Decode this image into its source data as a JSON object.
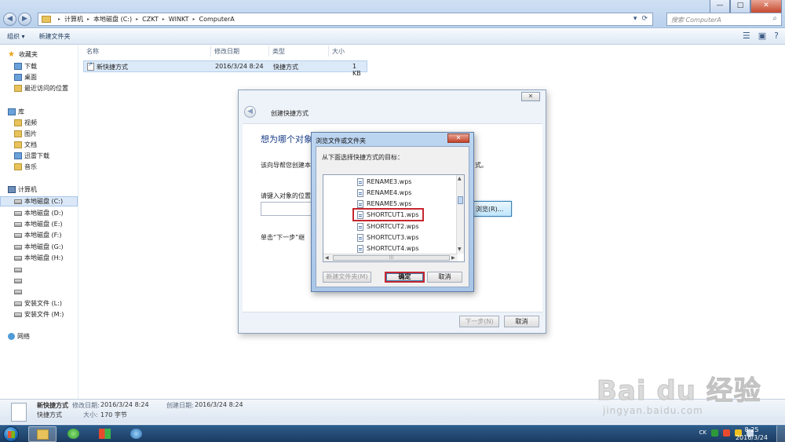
{
  "address": {
    "segments": [
      "计算机",
      "本地磁盘 (C:)",
      "CZKT",
      "WINKT",
      "ComputerA"
    ],
    "search_placeholder": "搜索 ComputerA"
  },
  "toolbar": {
    "organize": "组织 ▾",
    "new_folder": "新建文件夹"
  },
  "sidebar": {
    "favorites": "收藏夹",
    "downloads": "下载",
    "desktop": "桌面",
    "recent": "最近访问的位置",
    "libraries": "库",
    "videos": "视频",
    "pictures": "图片",
    "documents": "文档",
    "xunlei": "迅雷下载",
    "music": "音乐",
    "computer": "计算机",
    "drives": [
      "本地磁盘 (C:)",
      "本地磁盘 (D:)",
      "本地磁盘 (E:)",
      "本地磁盘 (F:)",
      "本地磁盘 (G:)",
      "本地磁盘 (H:)",
      "",
      "",
      "",
      "安装文件 (L:)",
      "安装文件 (M:)"
    ],
    "network": "网络"
  },
  "filelist": {
    "headers": {
      "name": "名称",
      "modified": "修改日期",
      "type": "类型",
      "size": "大小"
    },
    "rows": [
      {
        "name": "新快捷方式",
        "modified": "2016/3/24 8:24",
        "type": "快捷方式",
        "size": "1 KB"
      }
    ]
  },
  "wizard": {
    "title": "创建快捷方式",
    "close": "✕",
    "heading": "想为哪个对象",
    "desc": "该向导帮您创建本",
    "desc_tail": "式。",
    "location_label": "请键入对象的位置(",
    "browse_button": "浏览(R)...",
    "next_hint": "单击“下一步”继",
    "next_button": "下一步(N)",
    "cancel_button": "取消"
  },
  "browse_dialog": {
    "title": "浏览文件或文件夹",
    "close": "✕",
    "prompt": "从下面选择快捷方式的目标：",
    "items": [
      "RENAME3.wps",
      "RENAME4.wps",
      "RENAME5.wps",
      "SHORTCUT1.wps",
      "SHORTCUT2.wps",
      "SHORTCUT3.wps",
      "SHORTCUT4.wps"
    ],
    "selected_index": 3,
    "new_folder_button": "新建文件夹(M)",
    "ok_button": "确定",
    "cancel_button": "取消"
  },
  "details": {
    "name": "新快捷方式",
    "type": "快捷方式",
    "modified_label": "修改日期:",
    "modified_value": "2016/3/24 8:24",
    "created_label": "创建日期:",
    "created_value": "2016/3/24 8:24",
    "size_label": "大小:",
    "size_value": "170 字节"
  },
  "taskbar": {
    "tray_lang": "CK",
    "time": "8:25",
    "date": "2016/3/24"
  },
  "watermark": {
    "brand": "Bai du 经验",
    "url": "jingyan.baidu.com"
  }
}
